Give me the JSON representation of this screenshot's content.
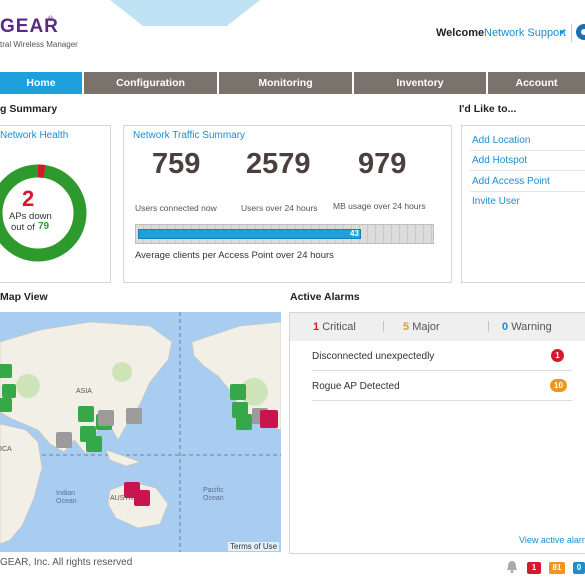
{
  "header": {
    "logo": "GEAR",
    "logo_sub": "tral Wireless Manager",
    "welcome": "Welcome",
    "user": "Network Support",
    "user_caret": "▾"
  },
  "nav": {
    "tabs": [
      {
        "label": "Home",
        "active": true
      },
      {
        "label": "Configuration",
        "active": false
      },
      {
        "label": "Monitoring",
        "active": false
      },
      {
        "label": "Inventory",
        "active": false
      },
      {
        "label": "Account",
        "active": false
      }
    ]
  },
  "summary": {
    "title": "g Summary"
  },
  "network_health": {
    "title": "Network Health",
    "aps_down": "2",
    "aps_down_label": "APs down",
    "out_of_label": "out of",
    "total": "79",
    "down_fraction": 0.025,
    "colors": {
      "healthy": "#2e9a2e",
      "down": "#d6182d"
    }
  },
  "traffic": {
    "title": "Network Traffic Summary",
    "stats": [
      {
        "value": "759",
        "label": "Users connected now"
      },
      {
        "value": "2579",
        "label": "Users over 24 hours"
      },
      {
        "value": "979",
        "label": "MB usage over 24 hours"
      }
    ],
    "avg_value": "43",
    "avg_fraction": 0.76,
    "avg_label": "Average clients per Access Point over 24 hours"
  },
  "actions": {
    "title": "I'd Like to...",
    "items": [
      "Add Location",
      "Add Hotspot",
      "Add Access Point",
      "Invite User"
    ]
  },
  "map": {
    "title": "Map View",
    "labels": {
      "asia": "ASIA",
      "ica": "ICA",
      "indian": "Indian\nOcean",
      "australia": "AUSTR",
      "pacific": "Pacific\nOcean"
    },
    "terms": "Terms of Use"
  },
  "alarms": {
    "title": "Active Alarms",
    "counts": [
      {
        "value": "1",
        "label": "Critical",
        "color": "#d6182d"
      },
      {
        "value": "5",
        "label": "Major",
        "color": "#f0961e"
      },
      {
        "value": "0",
        "label": "Warning",
        "color": "#1b8ed0"
      }
    ],
    "rows": [
      {
        "label": "Disconnected unexpectedly",
        "count": "1",
        "color": "#d6182d"
      },
      {
        "label": "Rogue AP Detected",
        "count": "10",
        "color": "#f0961e"
      }
    ],
    "view_link": "View active alarm"
  },
  "footer": {
    "copyright": "GEAR, Inc. All rights reserved",
    "badges": [
      {
        "value": "1",
        "color": "#d6182d"
      },
      {
        "value": "81",
        "color": "#f0961e"
      },
      {
        "value": "0",
        "color": "#1b8ed0"
      }
    ]
  }
}
